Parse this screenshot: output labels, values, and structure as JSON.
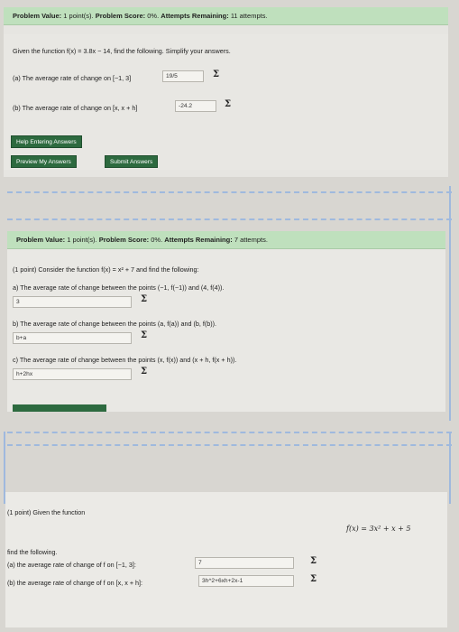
{
  "problem1": {
    "header": {
      "value_label": "Problem Value:",
      "value": "1 point(s).",
      "score_label": "Problem Score:",
      "score": "0%.",
      "attempts_label": "Attempts Remaining:",
      "attempts": "11 attempts."
    },
    "statement": "Given the function f(x) = 3.8x − 14, find the following. Simplify your answers.",
    "part_a": {
      "label": "(a) The average rate of change on [−1, 3]",
      "answer": "19/5"
    },
    "part_b": {
      "label": "(b) The average rate of change on [x, x + h]",
      "answer": "-24.2"
    },
    "buttons": {
      "help": "Help Entering Answers",
      "preview": "Preview My Answers",
      "submit": "Submit Answers"
    }
  },
  "problem2": {
    "header": {
      "value_label": "Problem Value:",
      "value": "1 point(s).",
      "score_label": "Problem Score:",
      "score": "0%.",
      "attempts_label": "Attempts Remaining:",
      "attempts": "7 attempts."
    },
    "statement": "(1 point) Consider the function f(x) = x² + 7 and find the following:",
    "part_a": {
      "label": "a) The average rate of change between the points (−1, f(−1)) and (4, f(4)).",
      "answer": "3"
    },
    "part_b": {
      "label": "b) The average rate of change between the points (a, f(a)) and (b, f(b)).",
      "answer": "b+a"
    },
    "part_c": {
      "label": "c) The average rate of change between the points (x, f(x)) and (x + h, f(x + h)).",
      "answer": "h+2hx"
    }
  },
  "problem3": {
    "intro": "(1 point) Given the function",
    "function": "f(x) = 3x² + x + 5",
    "find": "find the following.",
    "part_a": {
      "label": "(a) the average rate of change of f on [−1, 3]:",
      "answer": "7"
    },
    "part_b": {
      "label": "(b) the average rate of change of f on [x, x + h]:",
      "answer": "3h^2+6xh+2x-1"
    }
  },
  "icons": {
    "sigma": "Σ"
  }
}
